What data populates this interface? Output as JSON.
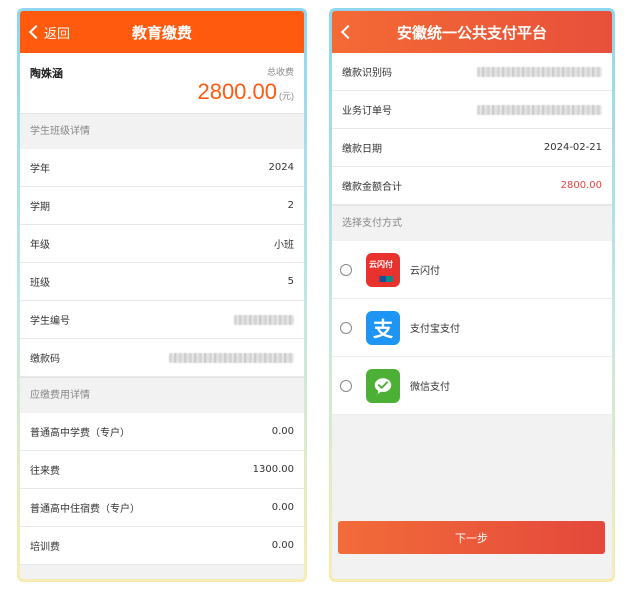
{
  "left": {
    "nav": {
      "back_label": "返回",
      "title": "教育缴费"
    },
    "summary": {
      "student_name": "陶姝涵",
      "total_label": "总收费",
      "amount": "2800.00",
      "unit": "(元)"
    },
    "class_section": {
      "heading": "学生班级详情",
      "rows": [
        {
          "label": "学年",
          "value": "2024"
        },
        {
          "label": "学期",
          "value": "2"
        },
        {
          "label": "年级",
          "value": "小班"
        },
        {
          "label": "班级",
          "value": "5"
        },
        {
          "label": "学生编号",
          "value": ""
        },
        {
          "label": "缴款码",
          "value": ""
        }
      ]
    },
    "fee_section": {
      "heading": "应缴费用详情",
      "rows": [
        {
          "label": "普通高中学费（专户）",
          "value": "0.00"
        },
        {
          "label": "往来费",
          "value": "1300.00"
        },
        {
          "label": "普通高中住宿费（专户）",
          "value": "0.00"
        },
        {
          "label": "培训费",
          "value": "0.00"
        }
      ]
    }
  },
  "right": {
    "nav": {
      "title": "安徽统一公共支付平台"
    },
    "info_rows": [
      {
        "label": "缴款识别码",
        "value": ""
      },
      {
        "label": "业务订单号",
        "value": ""
      },
      {
        "label": "缴款日期",
        "value": "2024-02-21"
      },
      {
        "label": "缴款金额合计",
        "value": "2800.00"
      }
    ],
    "pay_section_heading": "选择支付方式",
    "pay_options": [
      {
        "label": "云闪付",
        "icon": "unionpay-quickpass-icon",
        "icon_text": "云闪付"
      },
      {
        "label": "支付宝支付",
        "icon": "alipay-icon",
        "icon_text": "支"
      },
      {
        "label": "微信支付",
        "icon": "wechat-pay-icon"
      }
    ],
    "next_button_label": "下一步"
  },
  "colors": {
    "left_nav": "#ff5a0e",
    "right_nav": "#e8503a",
    "amount": "#ff5a0e",
    "total_red": "#e8433b",
    "frame_gradient_top": "#8fd6ee",
    "frame_gradient_bottom": "#f7edb4"
  }
}
